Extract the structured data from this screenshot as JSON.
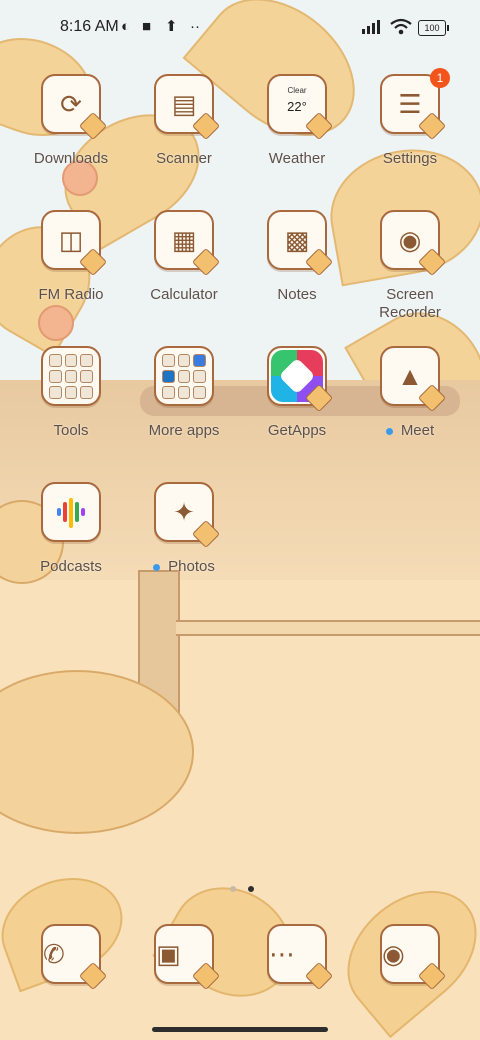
{
  "status_bar": {
    "time": "8:16 AM",
    "battery": "100",
    "icons": [
      "vpn-icon",
      "square-icon",
      "upload-icon",
      "more-dots-icon",
      "signal-icon",
      "wifi-icon",
      "battery-icon"
    ]
  },
  "apps": [
    {
      "label": "Downloads",
      "icon": "download-icon"
    },
    {
      "label": "Scanner",
      "icon": "scanner-icon"
    },
    {
      "label": "Weather",
      "icon": "weather-icon",
      "condition": "Clear",
      "temperature": "22°"
    },
    {
      "label": "Settings",
      "icon": "settings-icon",
      "badge": "1"
    },
    {
      "label": "FM Radio",
      "icon": "radio-icon"
    },
    {
      "label": "Calculator",
      "icon": "calculator-icon"
    },
    {
      "label": "Notes",
      "icon": "notes-icon"
    },
    {
      "label": "Screen Recorder",
      "icon": "recorder-icon"
    },
    {
      "label": "Tools",
      "icon": "folder-icon"
    },
    {
      "label": "More apps",
      "icon": "folder-icon"
    },
    {
      "label": "GetApps",
      "icon": "getapps-icon"
    },
    {
      "label": "Meet",
      "icon": "video-icon",
      "new": true
    },
    {
      "label": "Podcasts",
      "icon": "podcasts-icon"
    },
    {
      "label": "Photos",
      "icon": "pinwheel-icon",
      "new": true
    }
  ],
  "dock": [
    {
      "icon": "phone-icon"
    },
    {
      "icon": "gallery-icon"
    },
    {
      "icon": "messages-icon"
    },
    {
      "icon": "camera-icon"
    }
  ],
  "pager": {
    "pages": 2,
    "current": 2
  },
  "colors": {
    "accent": "#a8693e",
    "badge": "#f2541b",
    "new_dot": "#3b9bea"
  }
}
